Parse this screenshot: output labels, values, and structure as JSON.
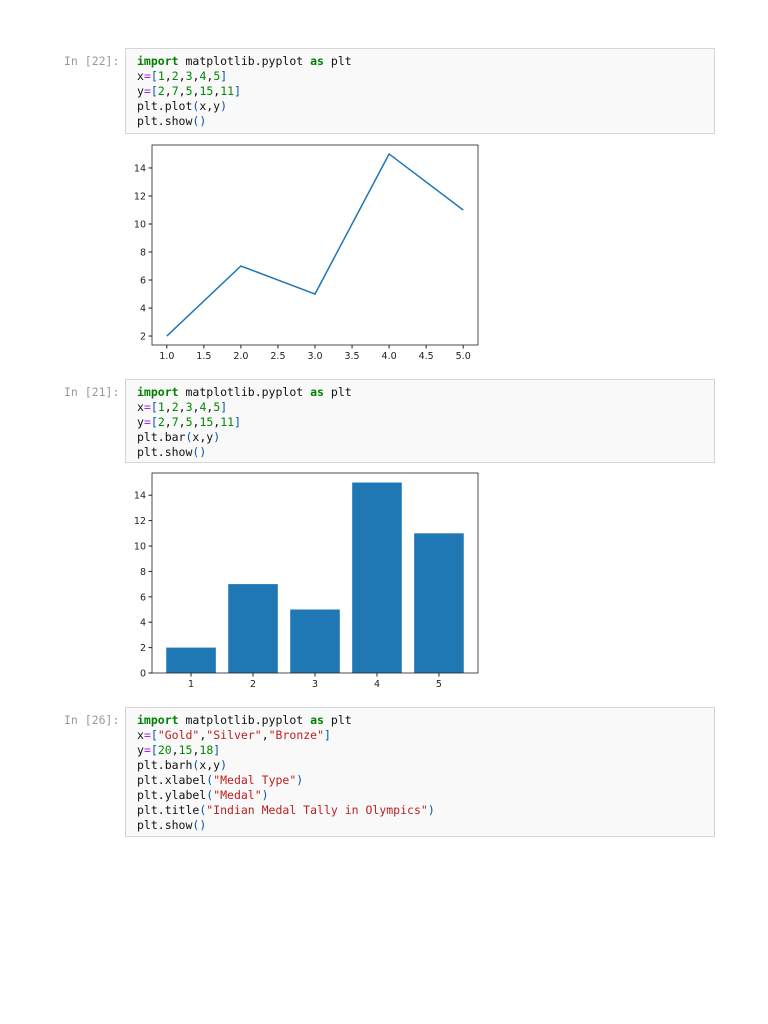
{
  "cells": [
    {
      "prompt": "In [22]:",
      "lines": [
        [
          [
            "kw",
            "import"
          ],
          [
            "t",
            " matplotlib.pyplot "
          ],
          [
            "kw",
            "as"
          ],
          [
            "t",
            " plt"
          ]
        ],
        [
          [
            "t",
            "x"
          ],
          [
            "op",
            "="
          ],
          [
            "br",
            "["
          ],
          [
            "num",
            "1"
          ],
          [
            "t",
            ","
          ],
          [
            "num",
            "2"
          ],
          [
            "t",
            ","
          ],
          [
            "num",
            "3"
          ],
          [
            "t",
            ","
          ],
          [
            "num",
            "4"
          ],
          [
            "t",
            ","
          ],
          [
            "num",
            "5"
          ],
          [
            "br",
            "]"
          ]
        ],
        [
          [
            "t",
            "y"
          ],
          [
            "op",
            "="
          ],
          [
            "br",
            "["
          ],
          [
            "num",
            "2"
          ],
          [
            "t",
            ","
          ],
          [
            "num",
            "7"
          ],
          [
            "t",
            ","
          ],
          [
            "num",
            "5"
          ],
          [
            "t",
            ","
          ],
          [
            "num",
            "15"
          ],
          [
            "t",
            ","
          ],
          [
            "num",
            "11"
          ],
          [
            "br",
            "]"
          ]
        ],
        [
          [
            "t",
            "plt.plot"
          ],
          [
            "br",
            "("
          ],
          [
            "t",
            "x,y"
          ],
          [
            "br",
            ")"
          ]
        ],
        [
          [
            "t",
            "plt.show"
          ],
          [
            "br",
            "()"
          ]
        ]
      ]
    },
    {
      "prompt": "In [21]:",
      "lines": [
        [
          [
            "kw",
            "import"
          ],
          [
            "t",
            " matplotlib.pyplot "
          ],
          [
            "kw",
            "as"
          ],
          [
            "t",
            " plt"
          ]
        ],
        [
          [
            "t",
            "x"
          ],
          [
            "op",
            "="
          ],
          [
            "br",
            "["
          ],
          [
            "num",
            "1"
          ],
          [
            "t",
            ","
          ],
          [
            "num",
            "2"
          ],
          [
            "t",
            ","
          ],
          [
            "num",
            "3"
          ],
          [
            "t",
            ","
          ],
          [
            "num",
            "4"
          ],
          [
            "t",
            ","
          ],
          [
            "num",
            "5"
          ],
          [
            "br",
            "]"
          ]
        ],
        [
          [
            "t",
            "y"
          ],
          [
            "op",
            "="
          ],
          [
            "br",
            "["
          ],
          [
            "num",
            "2"
          ],
          [
            "t",
            ","
          ],
          [
            "num",
            "7"
          ],
          [
            "t",
            ","
          ],
          [
            "num",
            "5"
          ],
          [
            "t",
            ","
          ],
          [
            "num",
            "15"
          ],
          [
            "t",
            ","
          ],
          [
            "num",
            "11"
          ],
          [
            "br",
            "]"
          ]
        ],
        [
          [
            "t",
            "plt.bar"
          ],
          [
            "br",
            "("
          ],
          [
            "t",
            "x,y"
          ],
          [
            "br",
            ")"
          ]
        ],
        [
          [
            "t",
            "plt.show"
          ],
          [
            "br",
            "()"
          ]
        ]
      ]
    },
    {
      "prompt": "In [26]:",
      "lines": [
        [
          [
            "kw",
            "import"
          ],
          [
            "t",
            " matplotlib.pyplot "
          ],
          [
            "kw",
            "as"
          ],
          [
            "t",
            " plt"
          ]
        ],
        [
          [
            "t",
            "x"
          ],
          [
            "op",
            "="
          ],
          [
            "br",
            "["
          ],
          [
            "str",
            "\"Gold\""
          ],
          [
            "t",
            ","
          ],
          [
            "str",
            "\"Silver\""
          ],
          [
            "t",
            ","
          ],
          [
            "str",
            "\"Bronze\""
          ],
          [
            "br",
            "]"
          ]
        ],
        [
          [
            "t",
            "y"
          ],
          [
            "op",
            "="
          ],
          [
            "br",
            "["
          ],
          [
            "num",
            "20"
          ],
          [
            "t",
            ","
          ],
          [
            "num",
            "15"
          ],
          [
            "t",
            ","
          ],
          [
            "num",
            "18"
          ],
          [
            "br",
            "]"
          ]
        ],
        [
          [
            "t",
            "plt.barh"
          ],
          [
            "br",
            "("
          ],
          [
            "t",
            "x,y"
          ],
          [
            "br",
            ")"
          ]
        ],
        [
          [
            "t",
            "plt.xlabel"
          ],
          [
            "br",
            "("
          ],
          [
            "str",
            "\"Medal Type\""
          ],
          [
            "br",
            ")"
          ]
        ],
        [
          [
            "t",
            "plt.ylabel"
          ],
          [
            "br",
            "("
          ],
          [
            "str",
            "\"Medal\""
          ],
          [
            "br",
            ")"
          ]
        ],
        [
          [
            "t",
            "plt.title"
          ],
          [
            "br",
            "("
          ],
          [
            "str",
            "\"Indian Medal Tally in Olympics\""
          ],
          [
            "br",
            ")"
          ]
        ],
        [
          [
            "t",
            "plt.show"
          ],
          [
            "br",
            "()"
          ]
        ]
      ]
    }
  ],
  "colors": {
    "series": "#1f77b4"
  },
  "chart_data": [
    {
      "type": "line",
      "x": [
        1,
        2,
        3,
        4,
        5
      ],
      "y": [
        2,
        7,
        5,
        15,
        11
      ],
      "xlim": [
        0.8,
        5.2
      ],
      "ylim": [
        1.36,
        15.64
      ],
      "xticks": [
        "1.0",
        "1.5",
        "2.0",
        "2.5",
        "3.0",
        "3.5",
        "4.0",
        "4.5",
        "5.0"
      ],
      "xtick_values": [
        1,
        1.5,
        2,
        2.5,
        3,
        3.5,
        4,
        4.5,
        5
      ],
      "yticks": [
        "2",
        "4",
        "6",
        "8",
        "10",
        "12",
        "14"
      ],
      "ytick_values": [
        2,
        4,
        6,
        8,
        10,
        12,
        14
      ]
    },
    {
      "type": "bar",
      "categories": [
        "1",
        "2",
        "3",
        "4",
        "5"
      ],
      "x": [
        1,
        2,
        3,
        4,
        5
      ],
      "values": [
        2,
        7,
        5,
        15,
        11
      ],
      "bar_width": 0.8,
      "xlim": [
        0.37,
        5.63
      ],
      "ylim": [
        0,
        15.75
      ],
      "yticks": [
        "0",
        "2",
        "4",
        "6",
        "8",
        "10",
        "12",
        "14"
      ],
      "ytick_values": [
        0,
        2,
        4,
        6,
        8,
        10,
        12,
        14
      ]
    }
  ]
}
